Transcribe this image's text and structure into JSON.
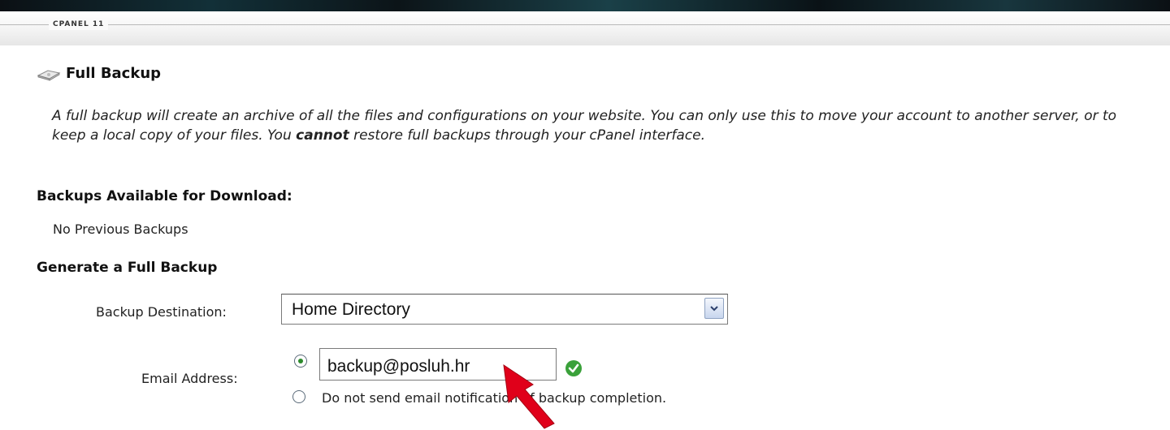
{
  "branding": "CPANEL 11",
  "page": {
    "title": "Full Backup",
    "description_part1": "A full backup will create an archive of all the files and configurations on your website. You can only use this to move your account to another server, or to keep a local copy of your files. You ",
    "description_emphasis": "cannot",
    "description_part2": " restore full backups through your cPanel interface."
  },
  "available": {
    "heading": "Backups Available for Download:",
    "empty_text": "No Previous Backups"
  },
  "generate": {
    "heading": "Generate a Full Backup",
    "destination_label": "Backup Destination:",
    "destination_value": "Home Directory",
    "email_label": "Email Address:",
    "email_value": "backup@posluh.hr",
    "no_email_label": "Do not send email notification of backup completion."
  },
  "colors": {
    "annotation_arrow": "#e0001a",
    "valid_check": "#3aa13a"
  },
  "icons": [
    "hard-drive-icon",
    "chevron-down-icon",
    "check-circle-icon",
    "annotation-arrow"
  ]
}
